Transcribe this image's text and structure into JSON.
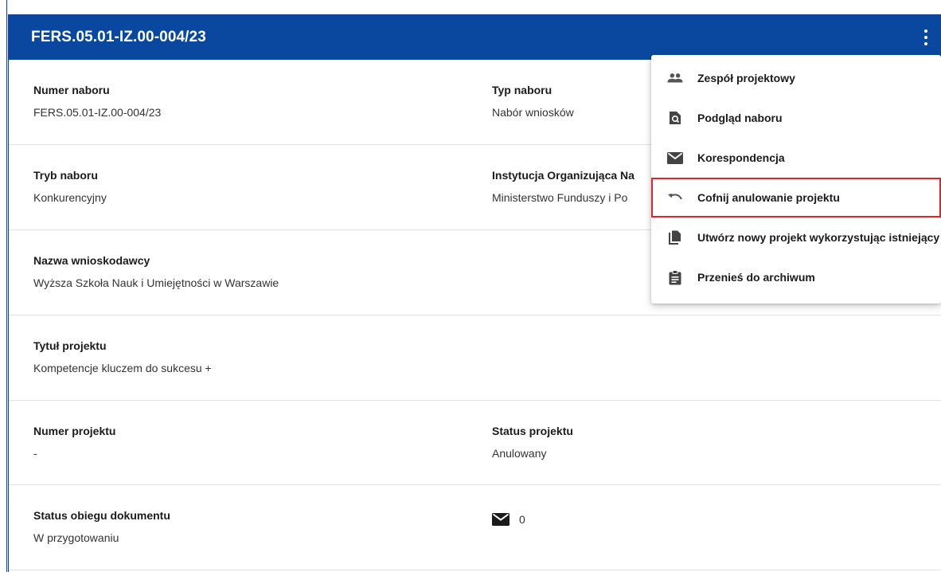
{
  "header": {
    "title": "FERS.05.01-IZ.00-004/23"
  },
  "fields": {
    "numer_naboru": {
      "label": "Numer naboru",
      "value": "FERS.05.01-IZ.00-004/23"
    },
    "typ_naboru": {
      "label": "Typ naboru",
      "value": "Nabór wniosków"
    },
    "tryb_naboru": {
      "label": "Tryb naboru",
      "value": "Konkurencyjny"
    },
    "instytucja": {
      "label": "Instytucja Organizująca Na",
      "value": "Ministerstwo Funduszy i Po"
    },
    "nazwa_wnioskodawcy": {
      "label": "Nazwa wnioskodawcy",
      "value": "Wyższa Szkoła Nauk i Umiejętności w Warszawie"
    },
    "tytul_projektu": {
      "label": "Tytuł projektu",
      "value": "Kompetencje kluczem do sukcesu +"
    },
    "numer_projektu": {
      "label": "Numer projektu",
      "value": "-"
    },
    "status_projektu": {
      "label": "Status projektu",
      "value": "Anulowany"
    },
    "status_obiegu": {
      "label": "Status obiegu dokumentu",
      "value": "W przygotowaniu"
    },
    "korespondencja_count": "0"
  },
  "menu": {
    "items": [
      {
        "label": "Zespół projektowy",
        "icon": "people-icon"
      },
      {
        "label": "Podgląd naboru",
        "icon": "document-search-icon"
      },
      {
        "label": "Korespondencja",
        "icon": "envelope-icon"
      },
      {
        "label": "Cofnij anulowanie projektu",
        "icon": "undo-icon"
      },
      {
        "label": "Utwórz nowy projekt wykorzystując istniejący",
        "icon": "copy-file-icon"
      },
      {
        "label": "Przenieś do archiwum",
        "icon": "clipboard-icon"
      }
    ]
  },
  "colors": {
    "header_bg": "#0a48a0",
    "highlight_border": "#e02727"
  }
}
